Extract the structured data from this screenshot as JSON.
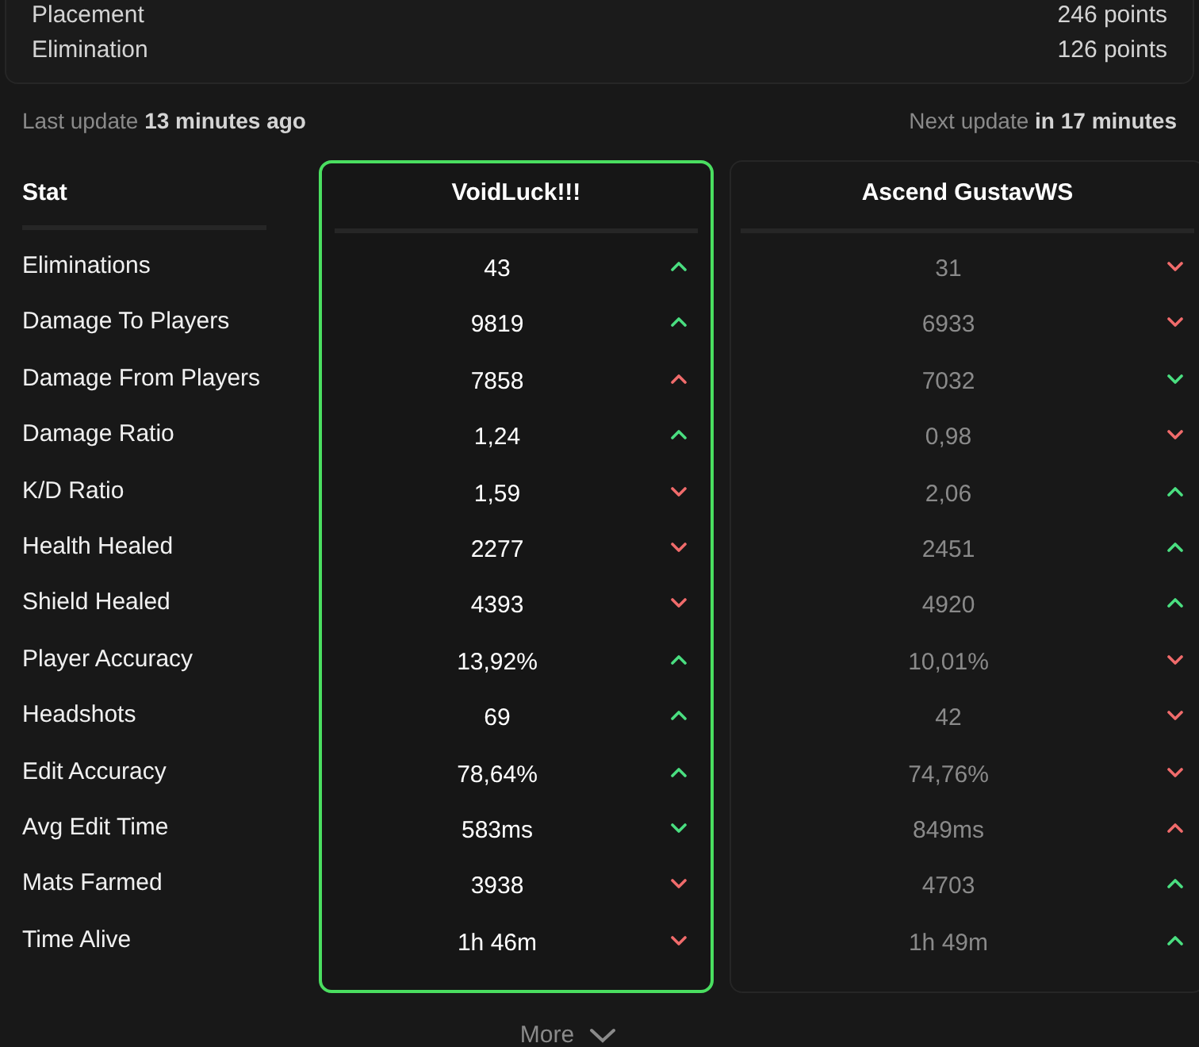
{
  "summary": {
    "rows": [
      {
        "label": "Placement",
        "value": "246 points"
      },
      {
        "label": "Elimination",
        "value": "126 points"
      }
    ]
  },
  "updates": {
    "last_label": "Last update",
    "last_value": "13 minutes ago",
    "next_label": "Next update",
    "next_value": "in 17 minutes"
  },
  "stat_header": "Stat",
  "stats": [
    "Eliminations",
    "Damage To Players",
    "Damage From Players",
    "Damage Ratio",
    "K/D Ratio",
    "Health Healed",
    "Shield Healed",
    "Player Accuracy",
    "Headshots",
    "Edit Accuracy",
    "Avg Edit Time",
    "Mats Farmed",
    "Time Alive"
  ],
  "players": [
    {
      "name": "VoidLuck!!!",
      "selected": true,
      "values": [
        {
          "value": "43",
          "kind": "up",
          "better": true
        },
        {
          "value": "9819",
          "kind": "up",
          "better": true
        },
        {
          "value": "7858",
          "kind": "up",
          "better": false
        },
        {
          "value": "1,24",
          "kind": "up",
          "better": true
        },
        {
          "value": "1,59",
          "kind": "down",
          "better": false
        },
        {
          "value": "2277",
          "kind": "down",
          "better": false
        },
        {
          "value": "4393",
          "kind": "down",
          "better": false
        },
        {
          "value": "13,92%",
          "kind": "up",
          "better": true
        },
        {
          "value": "69",
          "kind": "up",
          "better": true
        },
        {
          "value": "78,64%",
          "kind": "up",
          "better": true
        },
        {
          "value": "583ms",
          "kind": "down",
          "better": true
        },
        {
          "value": "3938",
          "kind": "down",
          "better": false
        },
        {
          "value": "1h 46m",
          "kind": "down",
          "better": false
        }
      ]
    },
    {
      "name": "Ascend GustavWS",
      "selected": false,
      "values": [
        {
          "value": "31",
          "kind": "down",
          "better": false
        },
        {
          "value": "6933",
          "kind": "down",
          "better": false
        },
        {
          "value": "7032",
          "kind": "down",
          "better": true
        },
        {
          "value": "0,98",
          "kind": "down",
          "better": false
        },
        {
          "value": "2,06",
          "kind": "up",
          "better": true
        },
        {
          "value": "2451",
          "kind": "up",
          "better": true
        },
        {
          "value": "4920",
          "kind": "up",
          "better": true
        },
        {
          "value": "10,01%",
          "kind": "down",
          "better": false
        },
        {
          "value": "42",
          "kind": "down",
          "better": false
        },
        {
          "value": "74,76%",
          "kind": "down",
          "better": false
        },
        {
          "value": "849ms",
          "kind": "up",
          "better": false
        },
        {
          "value": "4703",
          "kind": "up",
          "better": true
        },
        {
          "value": "1h 49m",
          "kind": "up",
          "better": true
        }
      ]
    }
  ],
  "more_button": "More"
}
